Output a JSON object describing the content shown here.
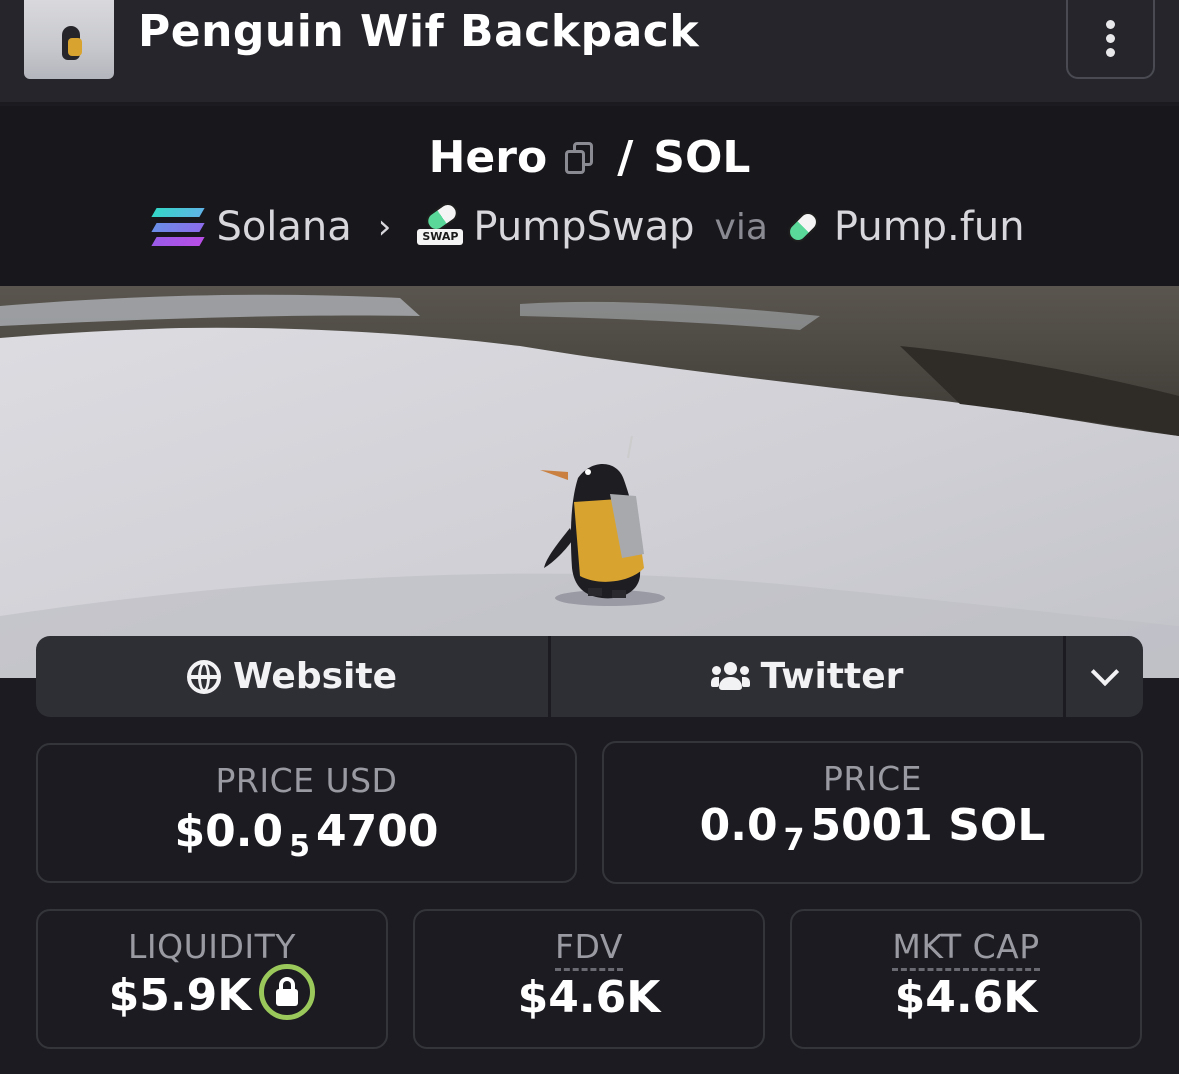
{
  "header": {
    "title": "Penguin Wif Backpack"
  },
  "pair": {
    "base": "Hero",
    "separator": "/",
    "quote": "SOL"
  },
  "chain": {
    "network": "Solana",
    "dex": "PumpSwap",
    "dex_badge": "SWAP",
    "via": "via",
    "launchpad": "Pump.fun"
  },
  "links": {
    "website": "Website",
    "twitter": "Twitter"
  },
  "stats": {
    "price_usd": {
      "label": "PRICE USD",
      "prefix": "$0.0",
      "zeros": "5",
      "digits": "4700"
    },
    "price": {
      "label": "PRICE",
      "prefix": "0.0",
      "zeros": "7",
      "digits": "5001 SOL"
    },
    "liquidity": {
      "label": "LIQUIDITY",
      "value": "$5.9K"
    },
    "fdv": {
      "label": "FDV",
      "value": "$4.6K"
    },
    "mkt_cap": {
      "label": "MKT CAP",
      "value": "$4.6K"
    }
  },
  "colors": {
    "background": "#1b1b21",
    "header": "#25252b",
    "lock_ring": "#9bc85a",
    "solana_gradient": [
      "#34d6c8",
      "#8b6cea",
      "#b84ee6"
    ]
  },
  "icons": [
    "more-vertical-icon",
    "copy-icon",
    "solana-icon",
    "chevron-right-icon",
    "pumpswap-icon",
    "pumpfun-icon",
    "globe-icon",
    "users-icon",
    "chevron-down-icon",
    "lock-icon"
  ]
}
